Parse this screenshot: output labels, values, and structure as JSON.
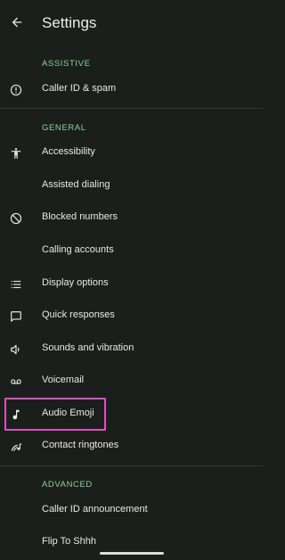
{
  "header": {
    "title": "Settings",
    "back_icon": "arrow-back-icon"
  },
  "sections": {
    "assistive": "ASSISTIVE",
    "general": "GENERAL",
    "advanced": "ADVANCED"
  },
  "items": {
    "caller_id_spam": {
      "label": "Caller ID & spam",
      "icon": "info-circle-icon"
    },
    "accessibility": {
      "label": "Accessibility",
      "icon": "accessibility-icon"
    },
    "assisted_dialing": {
      "label": "Assisted dialing"
    },
    "blocked_numbers": {
      "label": "Blocked numbers",
      "icon": "block-icon"
    },
    "calling_accounts": {
      "label": "Calling accounts"
    },
    "display_options": {
      "label": "Display options",
      "icon": "list-icon"
    },
    "quick_responses": {
      "label": "Quick responses",
      "icon": "message-icon"
    },
    "sounds_vibration": {
      "label": "Sounds and vibration",
      "icon": "volume-icon"
    },
    "voicemail": {
      "label": "Voicemail",
      "icon": "voicemail-icon"
    },
    "audio_emoji": {
      "label": "Audio Emoji",
      "icon": "music-note-icon"
    },
    "contact_ringtones": {
      "label": "Contact ringtones",
      "icon": "ringtone-icon"
    },
    "caller_id_announcement": {
      "label": "Caller ID announcement"
    },
    "flip_to_shhh": {
      "label": "Flip To Shhh"
    }
  },
  "colors": {
    "background": "#1b1f1c",
    "section_header": "#8fcf98",
    "highlight": "#e34dc4"
  }
}
